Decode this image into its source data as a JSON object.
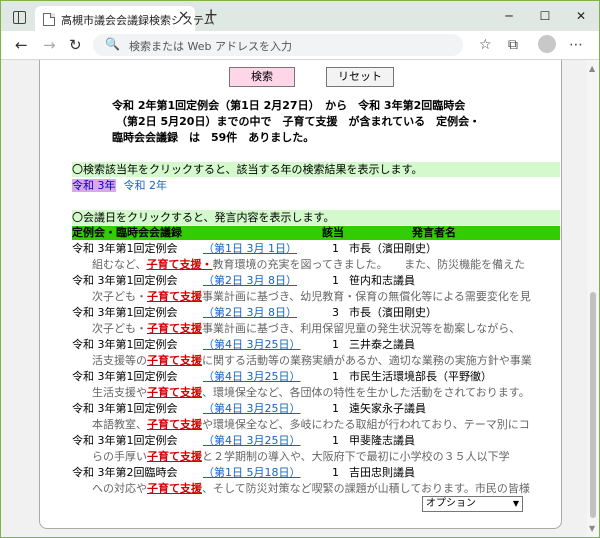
{
  "browser": {
    "tab_title": "高槻市議会会議録検索システム",
    "tab_close": "✕",
    "new_tab": "+",
    "window_controls": [
      "─",
      "☐",
      "✕"
    ],
    "nav": {
      "back": "←",
      "forward": "→",
      "reload": "↻"
    },
    "address_placeholder": "検索または Web アドレスを入力",
    "search_icon": "🔍",
    "toolbar_icons": {
      "favorite": "☆",
      "collections": "⧉",
      "extensions": "⊞",
      "menu": "⋯"
    }
  },
  "buttons": {
    "search": "検索",
    "reset": "リセット"
  },
  "summary_lines": [
    "令和 2年第1回定例会（第1日 2月27日）　から　令和 3年第2回臨時会",
    "（第2日 5月20日）までの中で　子育て支援　が含まれている　定例会・",
    "臨時会会議録　は　59件　ありました。"
  ],
  "year_section": {
    "instruction": "〇検索該当年をクリックすると、該当する年の検索結果を表示します。",
    "years": [
      "令和 3年",
      "令和 2年"
    ]
  },
  "meeting_section": {
    "instruction": "〇会議日をクリックすると、発言内容を表示します。",
    "headers": {
      "meeting": "定例会・臨時会会議録",
      "hits": "該当",
      "speaker": "発言者名"
    }
  },
  "results": [
    {
      "meeting": "令和 3年第1回定例会",
      "date": "（第1日 3月 1日）",
      "count": "1",
      "speaker": "市長（濱田剛史）",
      "before": "組むなど、",
      "keyword": "子育て支援・",
      "after": "教育環境の充実を図ってきました。　　また、防災機能を備えた"
    },
    {
      "meeting": "令和 3年第1回定例会",
      "date": "（第2日 3月 8日）",
      "count": "1",
      "speaker": "笹内和志議員",
      "before": "次子ども・",
      "keyword": "子育て支援",
      "after": "事業計画に基づき、幼児教育・保育の無償化等による需要変化を見"
    },
    {
      "meeting": "令和 3年第1回定例会",
      "date": "（第2日 3月 8日）",
      "count": "3",
      "speaker": "市長（濱田剛史）",
      "before": "次子ども・",
      "keyword": "子育て支援",
      "after": "事業計画に基づき、利用保留児童の発生状況等を勘案しながら、"
    },
    {
      "meeting": "令和 3年第1回定例会",
      "date": "（第4日 3月25日）",
      "count": "1",
      "speaker": "三井泰之議員",
      "before": "活支援等の",
      "keyword": "子育て支援",
      "after": "に関する活動等の業務実績があるか、適切な業務の実施方針や事業"
    },
    {
      "meeting": "令和 3年第1回定例会",
      "date": "（第4日 3月25日）",
      "count": "1",
      "speaker": "市民生活環境部長（平野徹）",
      "before": "生活支援や",
      "keyword": "子育て支援",
      "after": "、環境保全など、各団体の特性を生かした活動をされております。"
    },
    {
      "meeting": "令和 3年第1回定例会",
      "date": "（第4日 3月25日）",
      "count": "1",
      "speaker": "遠矢家永子議員",
      "before": "本語教室、",
      "keyword": "子育て支援",
      "after": "や環境保全など、多岐にわたる取組が行われており、テーマ別にコ"
    },
    {
      "meeting": "令和 3年第1回定例会",
      "date": "（第4日 3月25日）",
      "count": "1",
      "speaker": "甲斐隆志議員",
      "before": "らの手厚い",
      "keyword": "子育て支援",
      "after": "と２学期制の導入や、大阪府下で最初に小学校の３５人以下学"
    },
    {
      "meeting": "令和 3年第2回臨時会",
      "date": "（第1日 5月18日）",
      "count": "1",
      "speaker": "吉田忠則議員",
      "before": "への対応や",
      "keyword": "子育て支援",
      "after": "、そして防災対策など喫緊の課題が山積しております。市民の皆様"
    }
  ],
  "option_select": {
    "label": "オプション",
    "arrow": "▼"
  },
  "scroll": {
    "up": "▲",
    "down": "▼"
  }
}
